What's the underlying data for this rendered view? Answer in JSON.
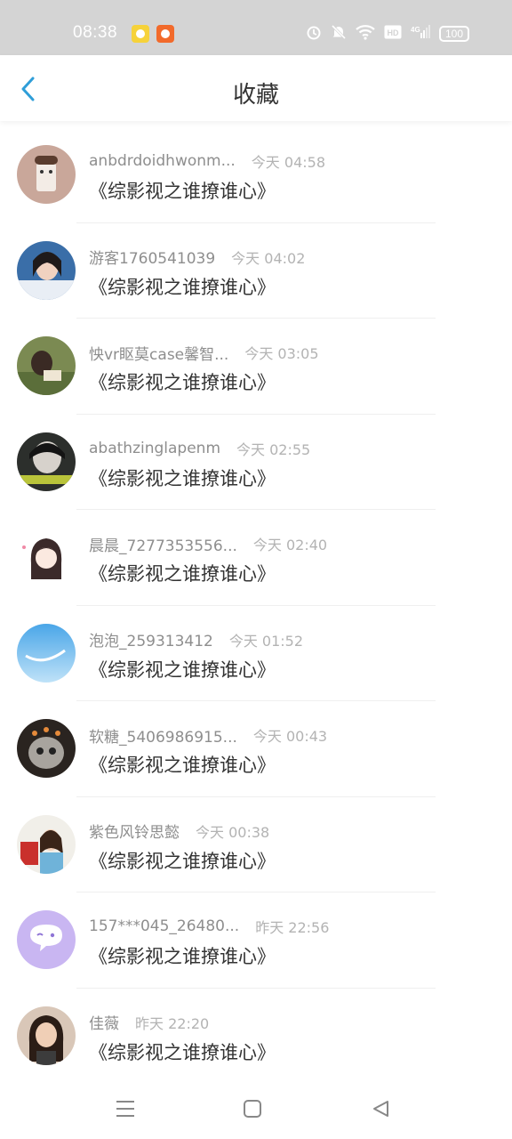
{
  "status_bar": {
    "time": "08:38",
    "battery": "100",
    "icons": [
      "alarm-icon",
      "mute-icon",
      "wifi-icon",
      "hd-icon",
      "4g-signal-icon",
      "battery-icon"
    ]
  },
  "header": {
    "title": "收藏",
    "back_icon": "chevron-left-icon",
    "accent_color": "#2f9ed8"
  },
  "favorites": [
    {
      "username": "anbdrdoidhwonm...",
      "time": "今天 04:58",
      "content": "《综影视之谁撩谁心》"
    },
    {
      "username": "游客1760541039",
      "time": "今天 04:02",
      "content": "《综影视之谁撩谁心》"
    },
    {
      "username": "怏vr眍莫case馨智...",
      "time": "今天 03:05",
      "content": "《综影视之谁撩谁心》"
    },
    {
      "username": "abathzinglapenm",
      "time": "今天 02:55",
      "content": "《综影视之谁撩谁心》"
    },
    {
      "username": "晨晨_7277353556...",
      "time": "今天 02:40",
      "content": "《综影视之谁撩谁心》"
    },
    {
      "username": "泡泡_259313412",
      "time": "今天 01:52",
      "content": "《综影视之谁撩谁心》"
    },
    {
      "username": "软糖_5406986915...",
      "time": "今天 00:43",
      "content": "《综影视之谁撩谁心》"
    },
    {
      "username": "紫色风铃思懿",
      "time": "今天 00:38",
      "content": "《综影视之谁撩谁心》"
    },
    {
      "username": "157***045_26480...",
      "time": "昨天 22:56",
      "content": "《综影视之谁撩谁心》"
    },
    {
      "username": "佳薇",
      "time": "昨天 22:20",
      "content": "《综影视之谁撩谁心》"
    }
  ],
  "bottom_nav": {
    "icons": [
      "menu-icon",
      "home-square-icon",
      "back-triangle-icon"
    ]
  }
}
